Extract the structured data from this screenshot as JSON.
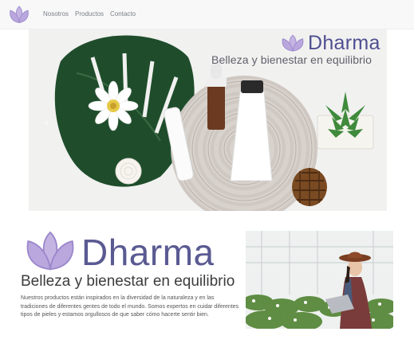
{
  "nav": {
    "links": [
      "Nosotros",
      "Productos",
      "Contacto"
    ]
  },
  "carousel": {
    "brand_word": "Dharma",
    "tagline": "Belleza y bienestar en equilibrio",
    "prev_icon": "‹"
  },
  "about": {
    "brand_word": "Dharma",
    "heading": "Belleza y bienestar en equilibrio",
    "body": "Nuestros productos están inspirados en la diversidad de la naturaleza y en las tradiciones de diferentes gentes de todo el mundo. Somos expertos en cuidar diferentes tipos de pieles y estamos orgullosos de que saber cómo hacerte sentir bien."
  },
  "colors": {
    "brand": "#5a5a92",
    "lotus": "#b8a8d8",
    "navbar_bg": "#f8f8f9"
  }
}
